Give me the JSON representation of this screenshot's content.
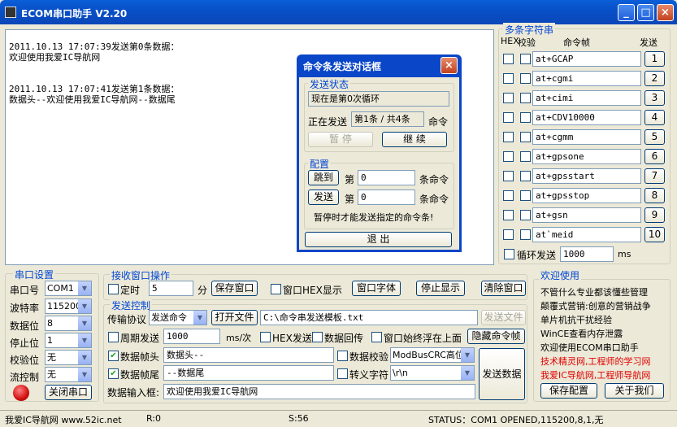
{
  "window": {
    "title": "ECOM串口助手  V2.20",
    "min": "_",
    "max": "□",
    "close": "×"
  },
  "receive": {
    "text": "2011.10.13 17:07:39发送第0条数据：\n欢迎使用我爱IC导航网\n\n\n2011.10.13 17:07:41发送第1条数据：\n数据头--欢迎使用我爱IC导航网--数据尾"
  },
  "dialog": {
    "title": "命令条发送对话框",
    "status_group": "发送状态",
    "loop_text": "现在是第0次循环",
    "sending_label": "正在发送",
    "sending_value": "第1条 / 共4条",
    "cmd_word": "命令",
    "pause": "暂    停",
    "continue": "继    续",
    "config_group": "配置",
    "jump": "跳到",
    "send": "发送",
    "di": "第",
    "jump_value": "0",
    "send_value": "0",
    "tiao_cmd": "条命令",
    "hint": "暂停时才能发送指定的命令条!",
    "exit": "退      出"
  },
  "multi": {
    "title": "多条字符串",
    "hex": "HEX",
    "verify": "校验",
    "cmdframe": "命令帧",
    "send_hdr": "发送",
    "commands": [
      {
        "text": "at+GCAP",
        "n": "1"
      },
      {
        "text": "at+cgmi",
        "n": "2"
      },
      {
        "text": "at+cimi",
        "n": "3"
      },
      {
        "text": "at+CDV10000",
        "n": "4"
      },
      {
        "text": "at+cgmm",
        "n": "5"
      },
      {
        "text": "at+gpsone",
        "n": "6"
      },
      {
        "text": "at+gpsstart",
        "n": "7"
      },
      {
        "text": "at+gpsstop",
        "n": "8"
      },
      {
        "text": "at+gsn",
        "n": "9"
      },
      {
        "text": "at`meid",
        "n": "10"
      }
    ],
    "loop_label": "循环发送",
    "loop_value": "1000",
    "ms": "ms"
  },
  "serial": {
    "title": "串口设置",
    "port_label": "串口号",
    "port": "COM1",
    "baud_label": "波特率",
    "baud": "115200",
    "data_label": "数据位",
    "data": "8",
    "stop_label": "停止位",
    "stop": "1",
    "parity_label": "校验位",
    "parity": "无",
    "flow_label": "流控制",
    "flow": "无",
    "close_btn": "关闭串口"
  },
  "recvops": {
    "title": "接收窗口操作",
    "timer_label": "定时",
    "timer_value": "5",
    "minute": "分",
    "save_btn": "保存窗口",
    "hex_label": "窗口HEX显示",
    "font_btn": "窗口字体",
    "stop_btn": "停止显示",
    "clear_btn": "清除窗口"
  },
  "sendctl": {
    "title": "发送控制",
    "proto_label": "传输协议",
    "proto": "发送命令",
    "open_btn": "打开文件",
    "file_path": "C:\\命令串发送模板.txt",
    "send_file_btn": "发送文件",
    "period_label": "周期发送",
    "period_value": "1000",
    "ms_unit": "ms/次",
    "hex_send": "HEX发送",
    "echo": "数据回传",
    "ontop": "窗口始终浮在上面",
    "hide_btn": "隐藏命令帧",
    "head_label": "数据帧头",
    "head_value": "数据头--",
    "verify_label": "数据校验",
    "verify_value": "ModBusCRC高位在",
    "tail_label": "数据帧尾",
    "tail_value": "--数据尾",
    "escape_label": "转义字符",
    "escape_value": "\\r\\n",
    "input_label": "数据输入框:",
    "input_value": "欢迎使用我爱IC导航网",
    "send_btn": "发送数据"
  },
  "welcome": {
    "title": "欢迎使用",
    "lines": [
      "不管什么专业都该懂些管理",
      "颠覆式营销:创意的营销战争",
      "单片机抗干扰经验",
      "WinCE查看内存泄露",
      "欢迎使用ECOM串口助手"
    ],
    "red_lines": [
      "技术精灵网,工程师的学习网",
      "我爱IC导航网,工程师导航网"
    ],
    "save_btn": "保存配置",
    "about_btn": "关于我们"
  },
  "statusbar": {
    "site": "我爱IC导航网 www.52ic.net",
    "r": "R:0",
    "s": "S:56",
    "status": "STATUS：COM1 OPENED,115200,8,1,无"
  },
  "colors": {
    "accent": "#0046d5",
    "red": "#e00000",
    "title_blue": "#0850c8"
  }
}
